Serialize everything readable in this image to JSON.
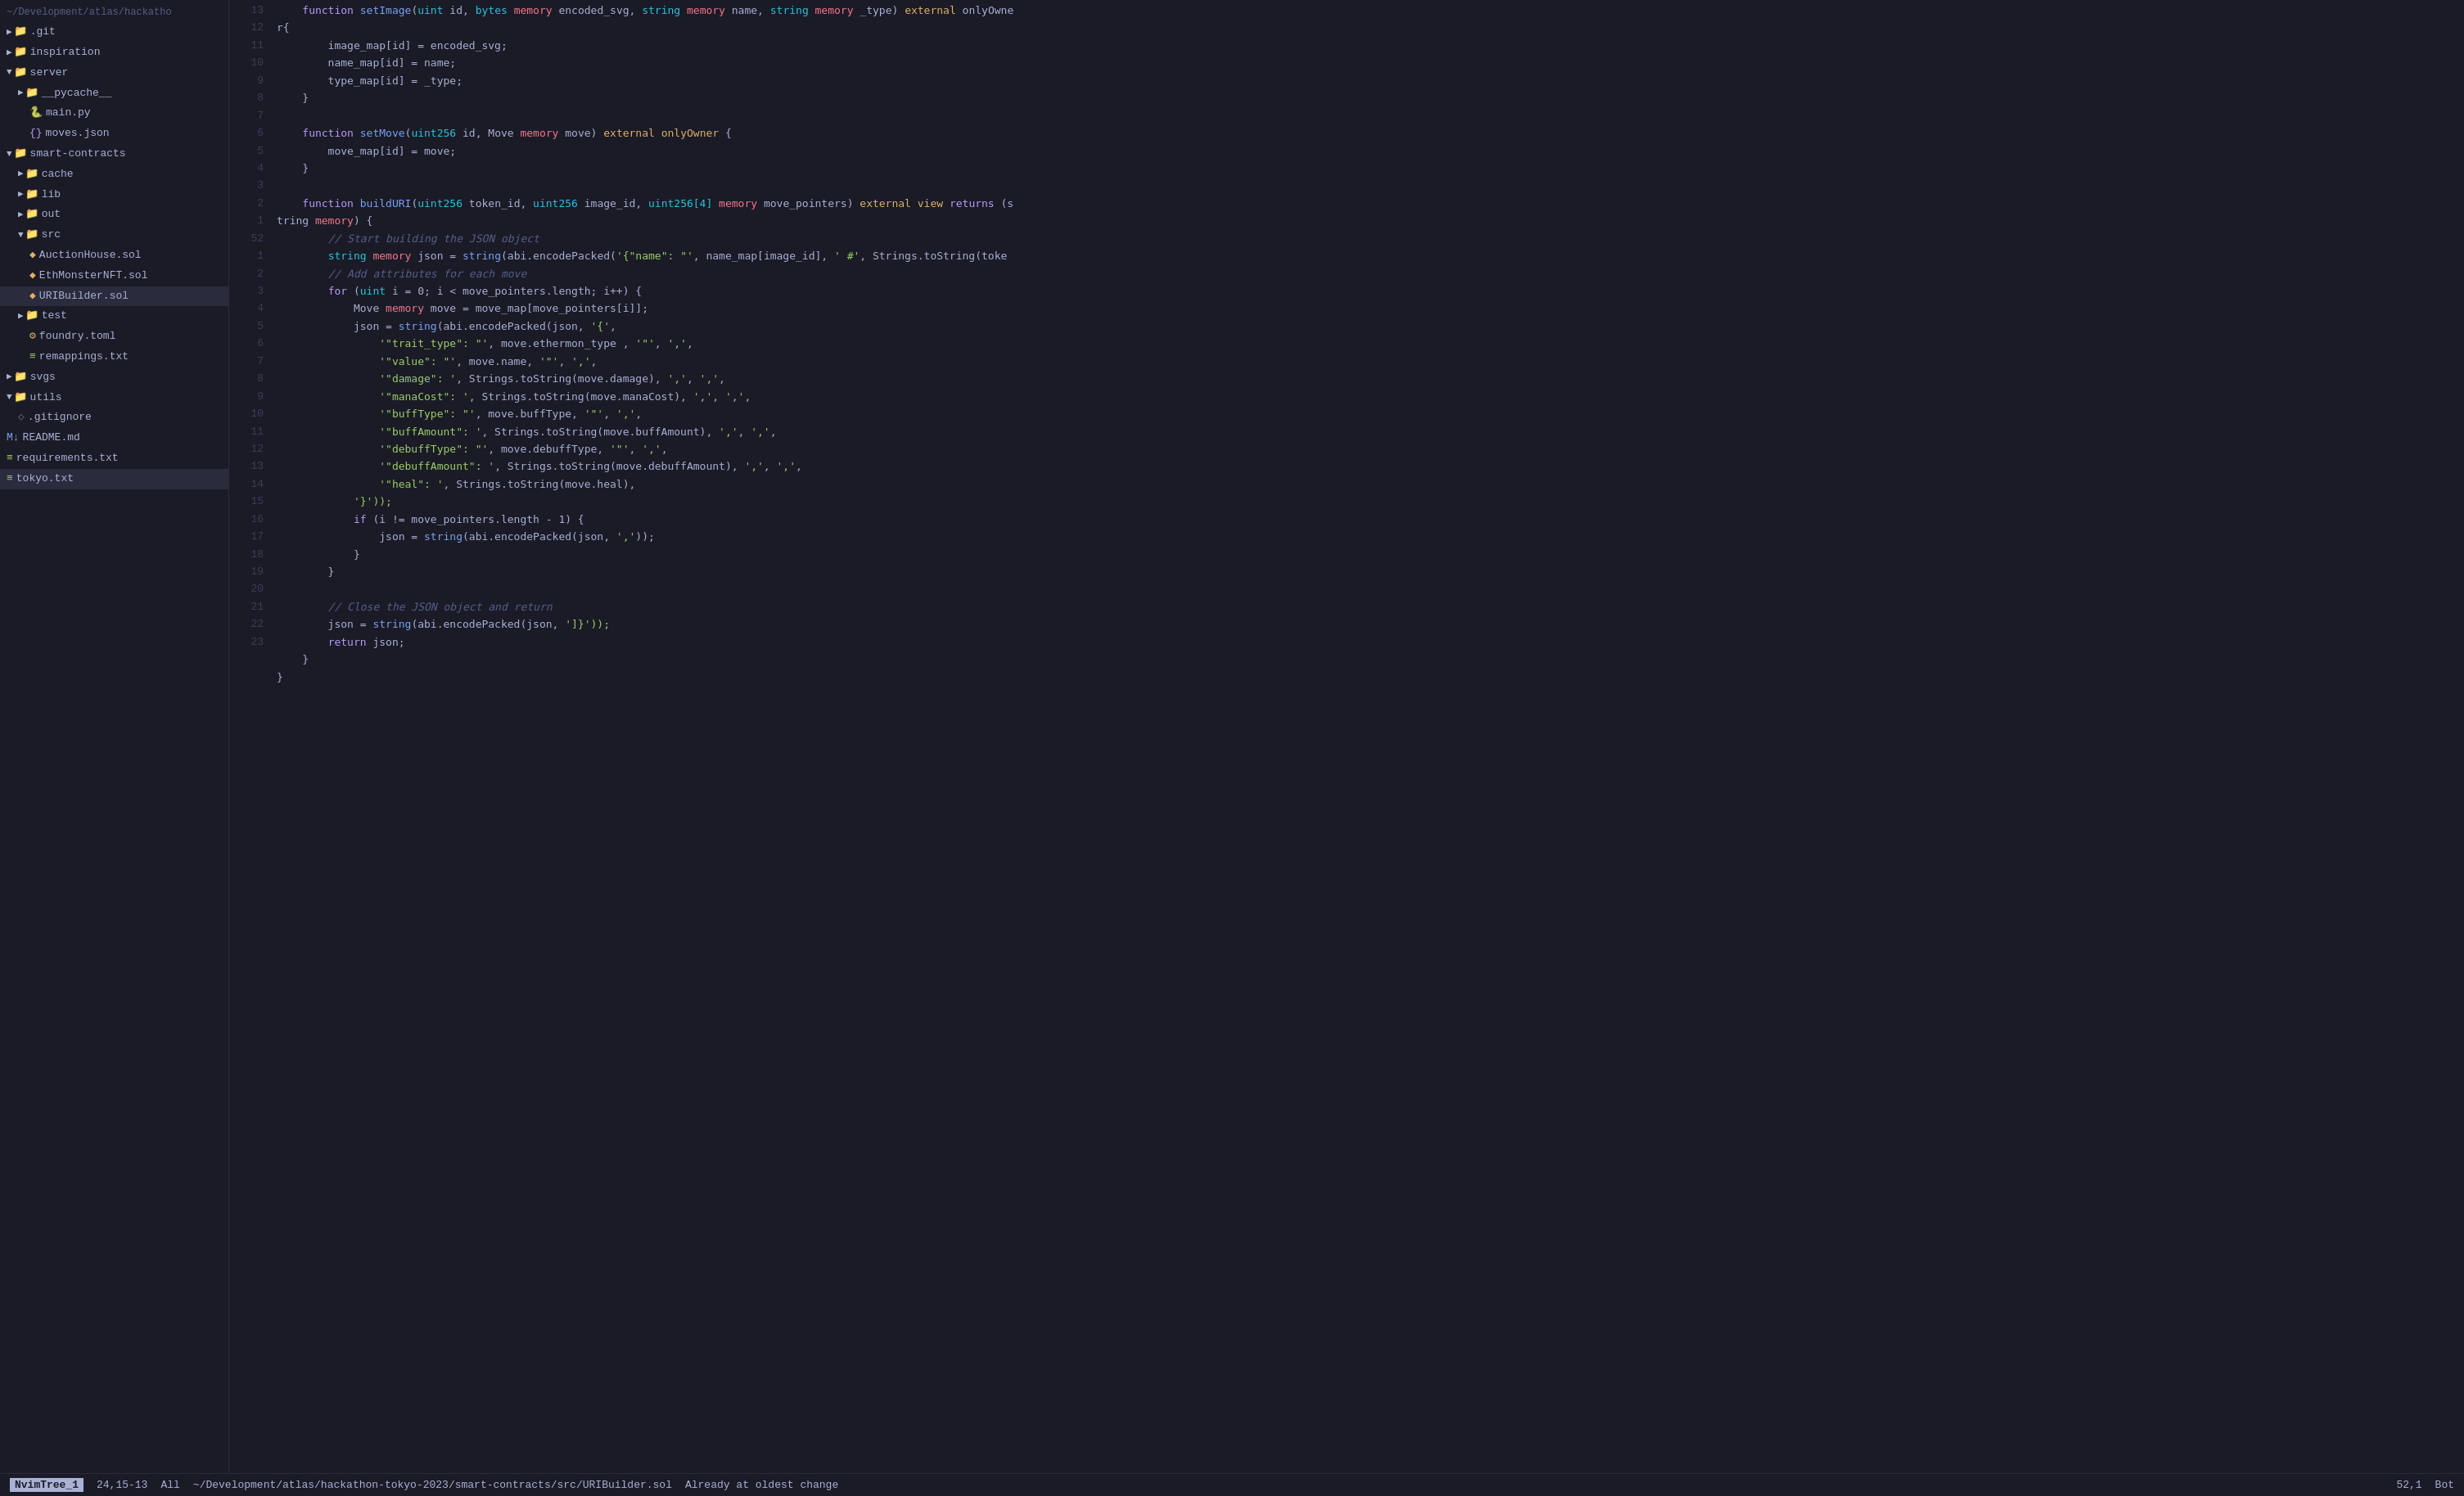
{
  "header": {
    "path": "~/Development/atlas/hackatho"
  },
  "sidebar": {
    "items": [
      {
        "id": "path",
        "label": "~/Development/atlas/hackatho",
        "indent": 0,
        "type": "path"
      },
      {
        "id": "git",
        "label": ".git",
        "indent": 1,
        "type": "folder",
        "arrow": "▶"
      },
      {
        "id": "inspiration",
        "label": "inspiration",
        "indent": 1,
        "type": "folder",
        "arrow": "▶"
      },
      {
        "id": "server",
        "label": "server",
        "indent": 1,
        "type": "folder",
        "arrow": "▼"
      },
      {
        "id": "pycache",
        "label": "__pycache__",
        "indent": 2,
        "type": "folder",
        "arrow": "▶"
      },
      {
        "id": "main-py",
        "label": "main.py",
        "indent": 2,
        "type": "file-py"
      },
      {
        "id": "moves-json",
        "label": "moves.json",
        "indent": 2,
        "type": "file-json"
      },
      {
        "id": "smart-contracts",
        "label": "smart-contracts",
        "indent": 1,
        "type": "folder",
        "arrow": "▼"
      },
      {
        "id": "cache",
        "label": "cache",
        "indent": 2,
        "type": "folder",
        "arrow": "▶"
      },
      {
        "id": "lib",
        "label": "lib",
        "indent": 2,
        "type": "folder",
        "arrow": "▶"
      },
      {
        "id": "out",
        "label": "out",
        "indent": 2,
        "type": "folder",
        "arrow": "▶"
      },
      {
        "id": "src",
        "label": "src",
        "indent": 2,
        "type": "folder",
        "arrow": "▼"
      },
      {
        "id": "auctionhouse",
        "label": "AuctionHouse.sol",
        "indent": 3,
        "type": "file-sol"
      },
      {
        "id": "ethmonster",
        "label": "EthMonsterNFT.sol",
        "indent": 3,
        "type": "file-sol"
      },
      {
        "id": "uribuilder",
        "label": "URIBuilder.sol",
        "indent": 3,
        "type": "file-sol",
        "active": true
      },
      {
        "id": "test",
        "label": "test",
        "indent": 2,
        "type": "folder",
        "arrow": "▶"
      },
      {
        "id": "foundry",
        "label": "foundry.toml",
        "indent": 2,
        "type": "file-toml"
      },
      {
        "id": "remappings",
        "label": "remappings.txt",
        "indent": 2,
        "type": "file-txt"
      },
      {
        "id": "svgs",
        "label": "svgs",
        "indent": 1,
        "type": "folder",
        "arrow": "▶"
      },
      {
        "id": "utils",
        "label": "utils",
        "indent": 1,
        "type": "folder",
        "arrow": "▼"
      },
      {
        "id": "gitignore",
        "label": ".gitignore",
        "indent": 2,
        "type": "file-txt"
      },
      {
        "id": "readme",
        "label": "README.md",
        "indent": 1,
        "type": "file-md"
      },
      {
        "id": "requirements",
        "label": "requirements.txt",
        "indent": 1,
        "type": "file-txt"
      },
      {
        "id": "tokyo",
        "label": "tokyo.txt",
        "indent": 1,
        "type": "file-txt",
        "cursor": true
      }
    ]
  },
  "code": {
    "lines": [
      {
        "num": 13,
        "content": "function_setImage_line"
      },
      {
        "num": 12,
        "content": "r_open_brace"
      },
      {
        "num": 12,
        "content": "image_map_line"
      },
      {
        "num": 11,
        "content": "name_map_line"
      },
      {
        "num": 10,
        "content": "type_map_line"
      },
      {
        "num": 9,
        "content": "close_brace"
      },
      {
        "num": 8,
        "content": "empty"
      },
      {
        "num": 7,
        "content": "setMove_line"
      },
      {
        "num": 6,
        "content": "move_map_line"
      },
      {
        "num": 5,
        "content": "close_brace_5"
      },
      {
        "num": 4,
        "content": "empty_4"
      },
      {
        "num": 3,
        "content": "buildURI_line"
      },
      {
        "num": 2,
        "content": "start_building_comment"
      },
      {
        "num": 1,
        "content": "string_memory_json_line"
      },
      {
        "num": 52,
        "content": "add_attributes_comment"
      },
      {
        "num": 1,
        "content": "for_loop_line"
      },
      {
        "num": 2,
        "content": "move_memory_line"
      },
      {
        "num": 3,
        "content": "json_encodePacked_line"
      },
      {
        "num": 4,
        "content": "trait_type_line"
      },
      {
        "num": 5,
        "content": "value_line"
      },
      {
        "num": 6,
        "content": "damage_line"
      },
      {
        "num": 7,
        "content": "manaCost_line"
      },
      {
        "num": 8,
        "content": "buffType_line"
      },
      {
        "num": 9,
        "content": "buffAmount_line"
      },
      {
        "num": 10,
        "content": "debuffType_line"
      },
      {
        "num": 11,
        "content": "debuffAmount_line"
      },
      {
        "num": 12,
        "content": "heal_line"
      },
      {
        "num": 13,
        "content": "close_bracket_line"
      },
      {
        "num": 14,
        "content": "if_i_line"
      },
      {
        "num": 15,
        "content": "json_comma_line"
      },
      {
        "num": 16,
        "content": "close_brace_16"
      },
      {
        "num": 17,
        "content": "close_brace_17"
      },
      {
        "num": 18,
        "content": "empty_18"
      },
      {
        "num": 19,
        "content": "close_json_comment"
      },
      {
        "num": 20,
        "content": "json_close_line"
      },
      {
        "num": 21,
        "content": "return_json_line"
      },
      {
        "num": 22,
        "content": "close_brace_22"
      },
      {
        "num": 23,
        "content": "close_brace_23"
      }
    ]
  },
  "status_bar": {
    "mode": "NvimTree_1",
    "position": "24,15-13",
    "percentage": "All",
    "filepath": "~/Development/atlas/hackathon-tokyo-2023/smart-contracts/src/URIBuilder.sol",
    "line_col": "52,1",
    "side_label": "Bot",
    "message": "Already at oldest change"
  }
}
